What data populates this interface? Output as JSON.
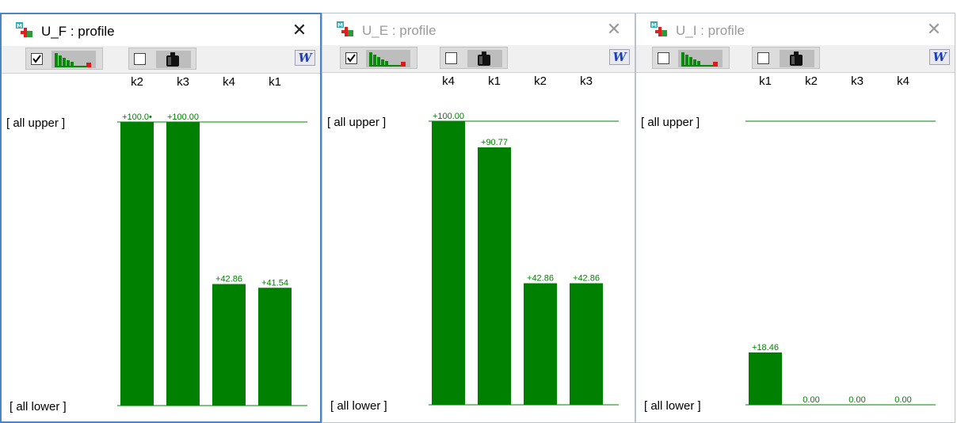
{
  "windows": [
    {
      "title": "U_F : profile",
      "state": "active",
      "checkbox_bars": true,
      "checkbox_weight": false,
      "y_upper_label": "[ all upper ]",
      "y_lower_label": "[ all lower ]",
      "chart_data": {
        "type": "bar",
        "categories": [
          "k2",
          "k3",
          "k4",
          "k1"
        ],
        "values": [
          100.0,
          100.0,
          42.86,
          41.54
        ],
        "value_labels": [
          "+100.0•",
          "+100.00",
          "+42.86",
          "+41.54"
        ],
        "ylim": [
          0,
          100
        ],
        "bar_color": "#008000"
      }
    },
    {
      "title": "U_E : profile",
      "state": "inactive",
      "checkbox_bars": true,
      "checkbox_weight": false,
      "y_upper_label": "[ all upper ]",
      "y_lower_label": "[ all lower ]",
      "chart_data": {
        "type": "bar",
        "categories": [
          "k4",
          "k1",
          "k2",
          "k3"
        ],
        "values": [
          100.0,
          90.77,
          42.86,
          42.86
        ],
        "value_labels": [
          "+100.00",
          "+90.77",
          "+42.86",
          "+42.86"
        ],
        "ylim": [
          0,
          100
        ],
        "bar_color": "#008000"
      }
    },
    {
      "title": "U_I : profile",
      "state": "inactive",
      "checkbox_bars": false,
      "checkbox_weight": false,
      "y_upper_label": "[ all upper ]",
      "y_lower_label": "[ all lower ]",
      "chart_data": {
        "type": "bar",
        "categories": [
          "k1",
          "k2",
          "k3",
          "k4"
        ],
        "values": [
          18.46,
          0.0,
          0.0,
          0.0
        ],
        "value_labels": [
          "+18.46",
          "0.00",
          "0.00",
          "0.00"
        ],
        "ylim": [
          0,
          100
        ],
        "bar_color": "#008000"
      }
    }
  ],
  "toolbar": {
    "w_button_label": "W"
  },
  "close_label": "✕",
  "colors": {
    "bar": "#008000",
    "axis": "#008000",
    "active_border": "#4a86c5"
  },
  "icons": [
    "app-icon",
    "bar-chart-icon",
    "weight-icon",
    "word-export-icon",
    "close-icon"
  ]
}
